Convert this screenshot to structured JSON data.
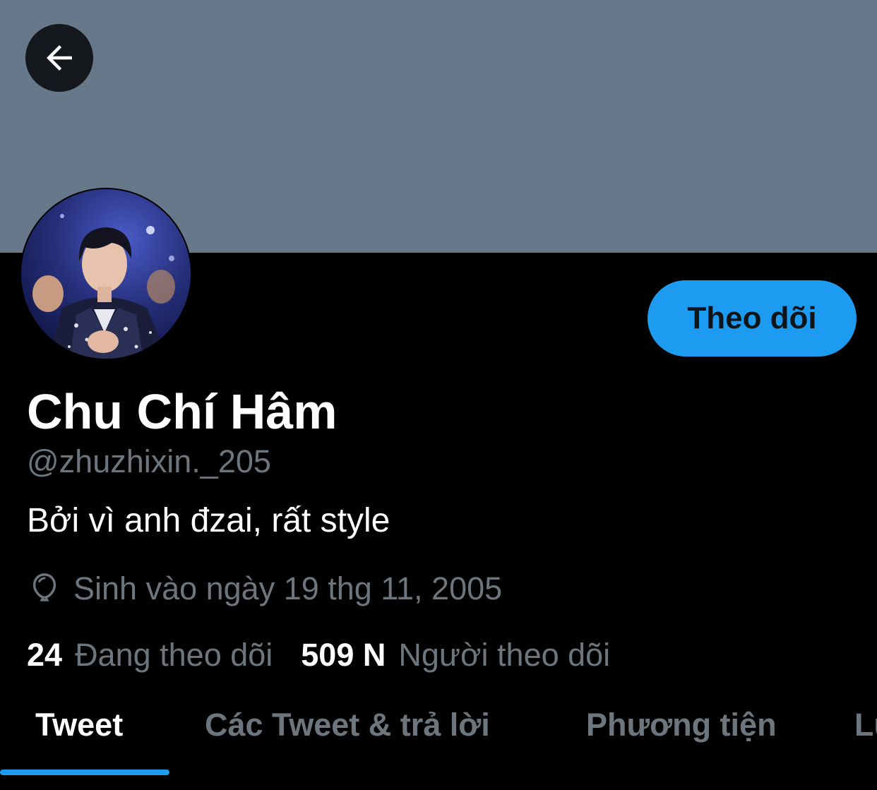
{
  "colors": {
    "banner": "#66788a",
    "accent": "#1d9bf0",
    "secondary_text": "#6e767d",
    "tab_inactive": "#6e767d"
  },
  "header": {
    "back_icon": "arrow-left-icon"
  },
  "profile": {
    "follow_label": "Theo dõi",
    "display_name": "Chu Chí Hâm",
    "handle": "@zhuzhixin._205",
    "bio": "Bởi vì anh đzai, rất style",
    "birth_icon": "balloon-icon",
    "birth_text": "Sinh vào ngày 19 thg 11, 2005"
  },
  "stats": {
    "following_count": "24",
    "following_label": "Đang theo dõi",
    "followers_count": "509 N",
    "followers_label": "Người theo dõi"
  },
  "tabs": [
    {
      "label": "Tweet",
      "active": true
    },
    {
      "label": "Các Tweet & trả lời",
      "active": false
    },
    {
      "label": "Phương tiện",
      "active": false
    },
    {
      "label": "Lư",
      "active": false
    }
  ]
}
